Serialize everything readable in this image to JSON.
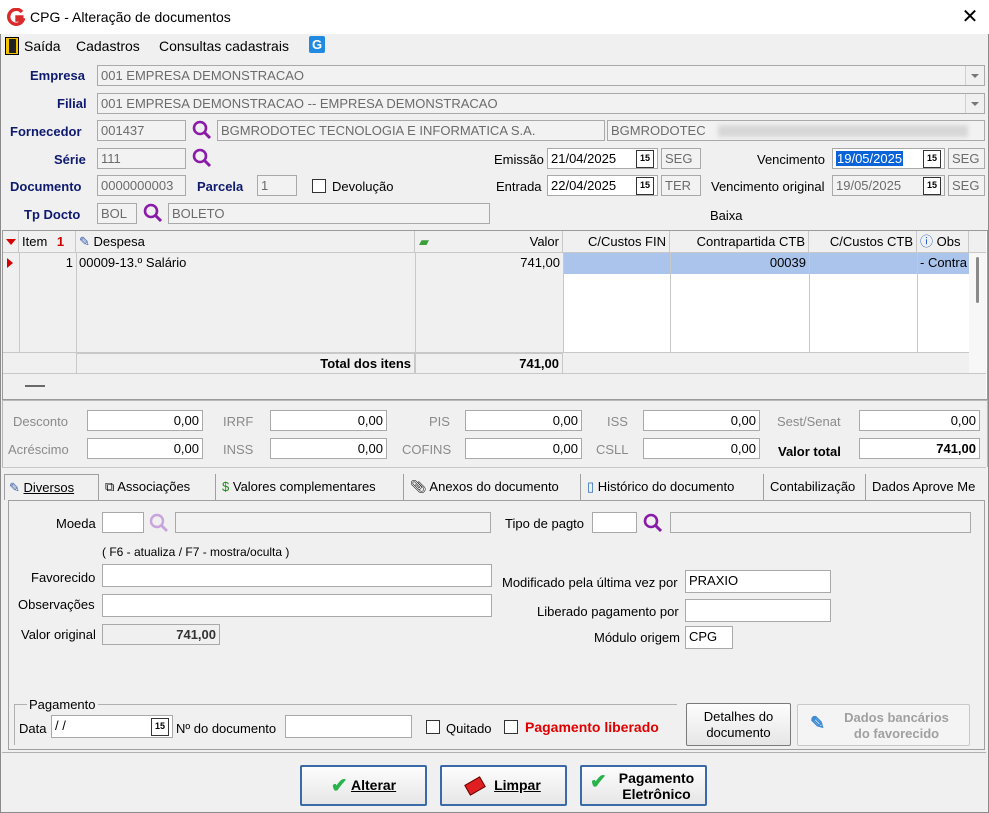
{
  "window": {
    "title": "CPG - Alteração de documentos"
  },
  "menu": [
    "Saída",
    "Cadastros",
    "Consultas cadastrais"
  ],
  "header": {
    "empresa_label": "Empresa",
    "empresa_value": "001 EMPRESA DEMONSTRACAO",
    "filial_label": "Filial",
    "filial_value": "001 EMPRESA DEMONSTRACAO -- EMPRESA DEMONSTRACAO",
    "fornecedor_label": "Fornecedor",
    "fornecedor_code": "001437",
    "fornecedor_name": "BGMRODOTEC TECNOLOGIA E INFORMATICA S.A.",
    "fornecedor_short": "BGMRODOTEC",
    "serie_label": "Série",
    "serie_value": "111",
    "documento_label": "Documento",
    "documento_value": "0000000003",
    "parcela_label": "Parcela",
    "parcela_value": "1",
    "devolucao_label": "Devolução",
    "tpdocto_label": "Tp Docto",
    "tpdocto_code": "BOL",
    "tpdocto_name": "BOLETO",
    "emissao_label": "Emissão",
    "emissao_value": "21/04/2025",
    "emissao_day": "SEG",
    "entrada_label": "Entrada",
    "entrada_value": "22/04/2025",
    "entrada_day": "TER",
    "vencimento_label": "Vencimento",
    "vencimento_value": "19/05/2025",
    "vencimento_day": "SEG",
    "venc_orig_label": "Vencimento original",
    "venc_orig_value": "19/05/2025",
    "venc_orig_day": "SEG",
    "baixa_label": "Baixa",
    "cal_glyph": "15"
  },
  "grid": {
    "columns": [
      "Item",
      "Despesa",
      "Valor",
      "C/Custos FIN",
      "Contrapartida CTB",
      "C/Custos CTB",
      "Obs"
    ],
    "rows": [
      {
        "item": "1",
        "despesa": "00009-13.º Salário",
        "valor": "741,00",
        "ccfin": "",
        "contrapartida": "00039",
        "ccctb": "",
        "obs": "- Contra"
      }
    ],
    "total_label": "Total dos itens",
    "total_value": "741,00"
  },
  "totals": {
    "desconto_label": "Desconto",
    "desconto": "0,00",
    "acrescimo_label": "Acréscimo",
    "acrescimo": "0,00",
    "irrf_label": "IRRF",
    "irrf": "0,00",
    "inss_label": "INSS",
    "inss": "0,00",
    "pis_label": "PIS",
    "pis": "0,00",
    "cofins_label": "COFINS",
    "cofins": "0,00",
    "iss_label": "ISS",
    "iss": "0,00",
    "csll_label": "CSLL",
    "csll": "0,00",
    "sest_label": "Sest/Senat",
    "sest": "0,00",
    "valor_total_label": "Valor total",
    "valor_total": "741,00"
  },
  "tabs": [
    "Diversos",
    "Associações",
    "Valores complementares",
    "Anexos do documento",
    "Histórico do documento",
    "Contabilização",
    "Dados Aprove Me"
  ],
  "diversos": {
    "moeda_label": "Moeda",
    "moeda_value": "",
    "hint": "( F6 - atualiza / F7 - mostra/oculta )",
    "favorecido_label": "Favorecido",
    "observacoes_label": "Observações",
    "valor_original_label": "Valor original",
    "valor_original": "741,00",
    "tipo_pagto_label": "Tipo de pagto",
    "modificado_label": "Modificado pela última vez por",
    "modificado_value": "PRAXIO",
    "liberado_label": "Liberado pagamento por",
    "liberado_value": "",
    "modulo_label": "Módulo origem",
    "modulo_value": "CPG",
    "pagamento_group": "Pagamento",
    "data_label": "Data",
    "data_value": " /  /",
    "ndoc_label": "Nº do documento",
    "quitado_label": "Quitado",
    "liberado_flag_label": "Pagamento liberado",
    "detalhes_button": [
      "Detalhes do",
      "documento"
    ],
    "dados_bancarios_button": [
      "Dados bancários",
      "do favorecido"
    ]
  },
  "buttons": {
    "alterar": "Alterar",
    "limpar": "Limpar",
    "pagamento_line1": "Pagamento",
    "pagamento_line2": "Eletrônico"
  },
  "colors": {
    "label_blue": "#0d1a6e",
    "selection": "#0a64d8",
    "row_highlight": "#aac4ec",
    "red": "#e00000"
  }
}
